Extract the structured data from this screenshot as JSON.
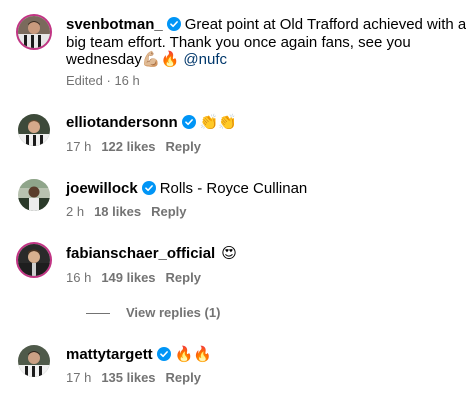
{
  "post": {
    "username": "svenbotman_",
    "caption_line1": "Great point at Old Trafford achieved with a",
    "caption_line2": "big team effort. Thank you once again fans, see you",
    "caption_line3": "wednesday",
    "caption_emoji": "💪🏼🔥",
    "mention": "@nufc",
    "edited_label": "Edited",
    "time": "16 h"
  },
  "comments": [
    {
      "username": "elliotandersonn",
      "text": "👏👏",
      "time": "17 h",
      "likes": "122 likes",
      "reply": "Reply"
    },
    {
      "username": "joewillock",
      "text": "Rolls - Royce Cullinan",
      "time": "2 h",
      "likes": "18 likes",
      "reply": "Reply"
    },
    {
      "username": "fabianschaer_official",
      "text": "😍",
      "time": "16 h",
      "likes": "149 likes",
      "reply": "Reply",
      "view_replies": "View replies (1)"
    },
    {
      "username": "mattytargett",
      "text": "🔥🔥",
      "time": "17 h",
      "likes": "135 likes",
      "reply": "Reply"
    }
  ],
  "colors": {
    "verified_blue": "#0095f6",
    "story_ring": "#c13584",
    "meta_gray": "#737373",
    "mention_blue": "#00376b"
  }
}
